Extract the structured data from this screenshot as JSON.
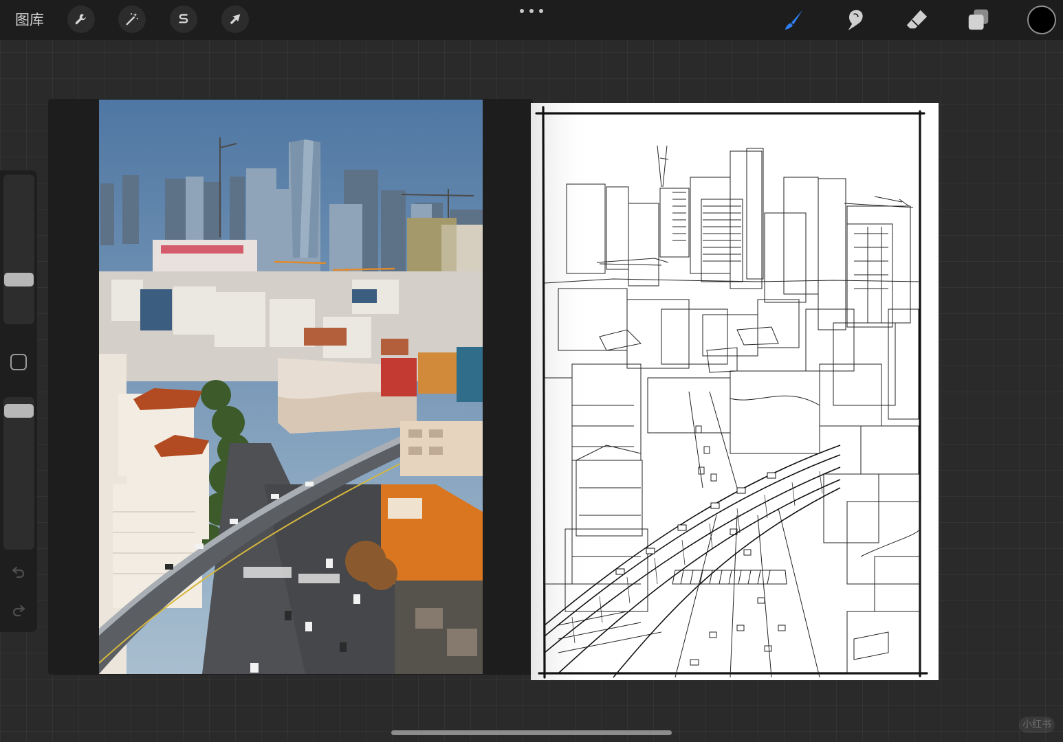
{
  "topbar": {
    "gallery_label": "图库",
    "left_tools": [
      {
        "name": "actions",
        "icon": "wrench-icon"
      },
      {
        "name": "adjustments",
        "icon": "magic-wand-icon"
      },
      {
        "name": "selection",
        "icon": "selection-s-icon"
      },
      {
        "name": "transform",
        "icon": "arrow-cursor-icon"
      }
    ],
    "more_icon": "ellipsis-icon",
    "right_tools": [
      {
        "name": "brush",
        "icon": "brush-icon",
        "active": true
      },
      {
        "name": "smudge",
        "icon": "smudge-finger-icon",
        "active": false
      },
      {
        "name": "eraser",
        "icon": "eraser-icon",
        "active": false
      },
      {
        "name": "layers",
        "icon": "layers-icon",
        "active": false
      }
    ],
    "current_color": "#000000"
  },
  "sidebar": {
    "brush_size_level": 0.28,
    "opacity_level": 0.95,
    "modify_icon": "square-icon",
    "undo_icon": "undo-icon",
    "redo_icon": "redo-icon"
  },
  "canvas": {
    "reference_photo": "city-overpass-photo",
    "line_art": "city-overpass-sketch"
  },
  "colors": {
    "accent": "#2f7ff2",
    "topbar_bg": "#1d1d1d",
    "canvas_bg": "#2a2a2a"
  },
  "watermark": "小红书"
}
